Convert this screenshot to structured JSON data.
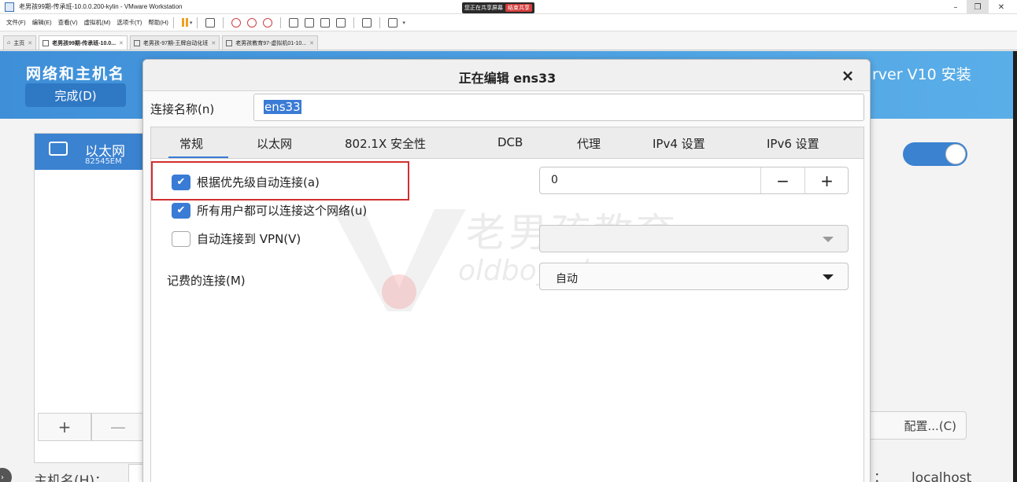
{
  "window": {
    "title": "老男孩99期-传承班-10.0.0.200-kylin - VMware Workstation",
    "share_banner": "您正在共享屏幕",
    "share_stop": "结束共享",
    "min_glyph": "–",
    "max_glyph": "❐",
    "close_glyph": "✕"
  },
  "menu": {
    "items": [
      "文件(F)",
      "编辑(E)",
      "查看(V)",
      "虚拟机(M)",
      "选项卡(T)",
      "帮助(H)"
    ]
  },
  "tabs": [
    {
      "label": "主页"
    },
    {
      "label": "老男孩99期-传承班-10.0..."
    },
    {
      "label": "老男孩-97期-王牌自动化班"
    },
    {
      "label": "老男孩教育97-虚拟机01-10..."
    }
  ],
  "guest": {
    "page_title": "网络和主机名",
    "done_button": "完成(D)",
    "installer_title": "rver V10 安装",
    "device_name": "以太网",
    "device_model": "82545EM",
    "add_button": "+",
    "remove_button": "—",
    "configure_button": "配置...(C)",
    "hostname_label": "主机名(H)：",
    "hostname_colon": "：",
    "hostname_value": "localhost",
    "toggle_on": true
  },
  "dialog": {
    "title": "正在编辑 ens33",
    "close_glyph": "×",
    "connection_name_label": "连接名称(n)",
    "connection_name_value": "ens33",
    "tabs": [
      "常规",
      "以太网",
      "802.1X 安全性",
      "DCB",
      "代理",
      "IPv4 设置",
      "IPv6 设置"
    ],
    "active_tab": "常规",
    "auto_connect_priority_label": "根据优先级自动连接(a)",
    "auto_connect_priority_checked": true,
    "priority_value": "0",
    "minus_glyph": "−",
    "plus_glyph": "+",
    "all_users_label": "所有用户都可以连接这个网络(u)",
    "all_users_checked": true,
    "vpn_label": "自动连接到 VPN(V)",
    "vpn_checked": false,
    "vpn_value": "",
    "metered_label": "记费的连接(M)",
    "metered_value": "自动",
    "check_glyph": "✔"
  },
  "watermark": {
    "cn": "老男孩教育",
    "en": "oldboyedu.com"
  },
  "colors": {
    "accent": "#3a7bd5",
    "header": "#4a9ee0",
    "highlight": "#d32f2f"
  }
}
